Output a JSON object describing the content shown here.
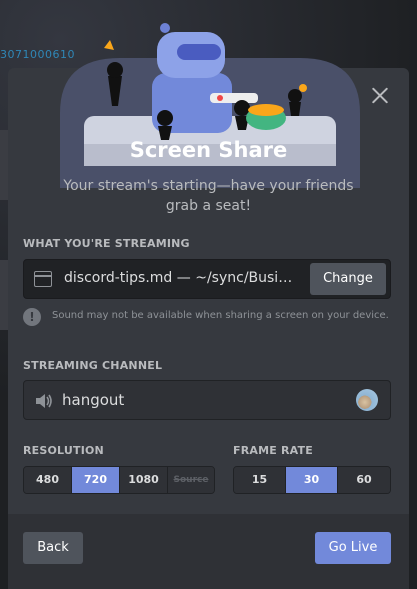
{
  "backdrop": {
    "text": "3071000610"
  },
  "modal": {
    "title": "Screen Share",
    "subtitle": "Your stream's starting—have your friends grab a seat!",
    "close_icon": "close-icon"
  },
  "source": {
    "label": "What you're streaming",
    "name": "discord-tips.md — ~/sync/Business",
    "change_label": "Change",
    "icon": "window-icon"
  },
  "warning": {
    "icon": "info-icon",
    "text": "Sound may not be available when sharing a screen on your device."
  },
  "channel": {
    "label": "Streaming Channel",
    "name": "hangout",
    "icon": "speaker-icon"
  },
  "resolution": {
    "label": "Resolution",
    "options": [
      "480",
      "720",
      "1080",
      "Source"
    ],
    "selected": "720",
    "disabled": [
      "Source"
    ]
  },
  "frame_rate": {
    "label": "Frame Rate",
    "options": [
      "15",
      "30",
      "60"
    ],
    "selected": "30"
  },
  "footer": {
    "back_label": "Back",
    "go_live_label": "Go Live"
  },
  "colors": {
    "accent": "#7289da",
    "modal_bg": "#36393f",
    "footer_bg": "#2f3136"
  }
}
